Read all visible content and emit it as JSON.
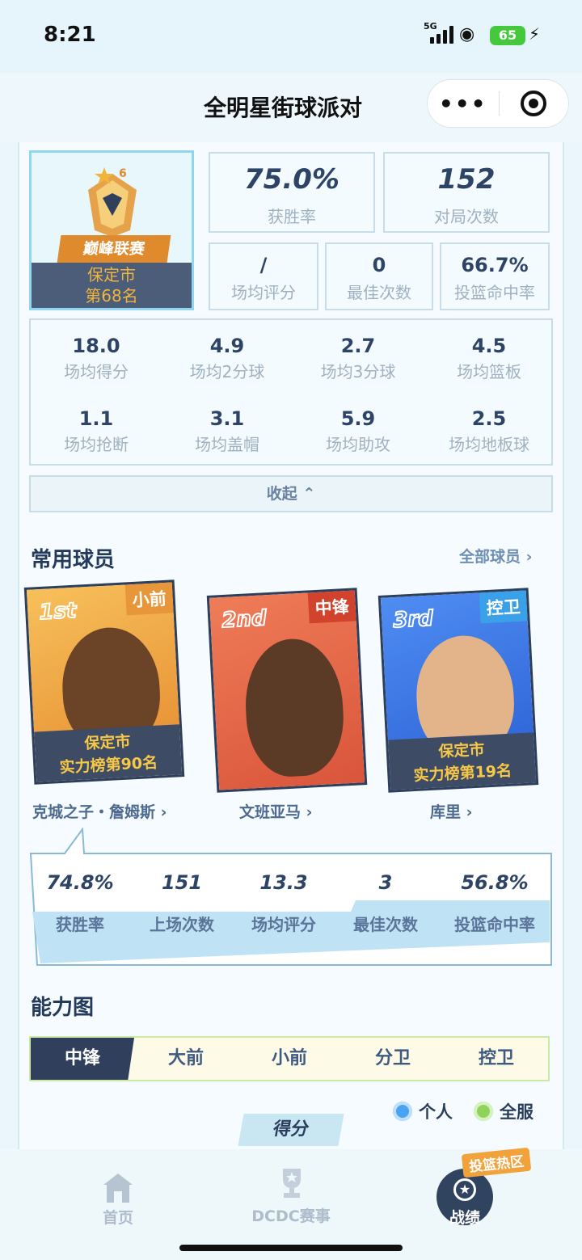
{
  "status_bar": {
    "time": "8:21",
    "network": "5G",
    "battery": "65"
  },
  "header": {
    "title": "全明星街球派对",
    "more_icon": "more-dots-icon",
    "target_icon": "target-icon"
  },
  "rank": {
    "star_level": "6",
    "league": "巅峰联赛",
    "city": "保定市",
    "position": "第68名"
  },
  "summary": {
    "win_rate": {
      "value": "75.0%",
      "label": "获胜率"
    },
    "matches": {
      "value": "152",
      "label": "对局次数"
    },
    "avg_rating": {
      "value": "/",
      "label": "场均评分"
    },
    "mvp_count": {
      "value": "0",
      "label": "最佳次数"
    },
    "fg_pct": {
      "value": "66.7%",
      "label": "投篮命中率"
    }
  },
  "detail_stats": [
    {
      "value": "18.0",
      "label": "场均得分"
    },
    {
      "value": "4.9",
      "label": "场均2分球"
    },
    {
      "value": "2.7",
      "label": "场均3分球"
    },
    {
      "value": "4.5",
      "label": "场均篮板"
    },
    {
      "value": "1.1",
      "label": "场均抢断"
    },
    {
      "value": "3.1",
      "label": "场均盖帽"
    },
    {
      "value": "5.9",
      "label": "场均助攻"
    },
    {
      "value": "2.5",
      "label": "场均地板球"
    }
  ],
  "collapse_label": "收起",
  "players_section": {
    "title": "常用球员",
    "all_link": "全部球员"
  },
  "players": [
    {
      "ordinal": "1st",
      "position": "小前",
      "city": "保定市",
      "rank_text": "实力榜第90名",
      "name": "克城之子・詹姆斯"
    },
    {
      "ordinal": "2nd",
      "position": "中锋",
      "city": "",
      "rank_text": "",
      "name": "文班亚马"
    },
    {
      "ordinal": "3rd",
      "position": "控卫",
      "city": "保定市",
      "rank_text": "实力榜第19名",
      "name": "库里"
    }
  ],
  "player_stats": [
    {
      "value": "74.8%",
      "label": "获胜率"
    },
    {
      "value": "151",
      "label": "上场次数"
    },
    {
      "value": "13.3",
      "label": "场均评分"
    },
    {
      "value": "3",
      "label": "最佳次数"
    },
    {
      "value": "56.8%",
      "label": "投篮命中率"
    }
  ],
  "ability": {
    "title": "能力图",
    "tabs": [
      "中锋",
      "大前",
      "小前",
      "分卫",
      "控卫"
    ],
    "active_tab": "中锋",
    "legend": {
      "personal": "个人",
      "global": "全服"
    },
    "metric": "得分",
    "colors": {
      "personal": "#4aa3f0",
      "global": "#8fd35a"
    }
  },
  "bottom_nav": {
    "home": "首页",
    "events": "DCDC赛事",
    "record": "战绩",
    "hot_zone": "投篮热区"
  }
}
